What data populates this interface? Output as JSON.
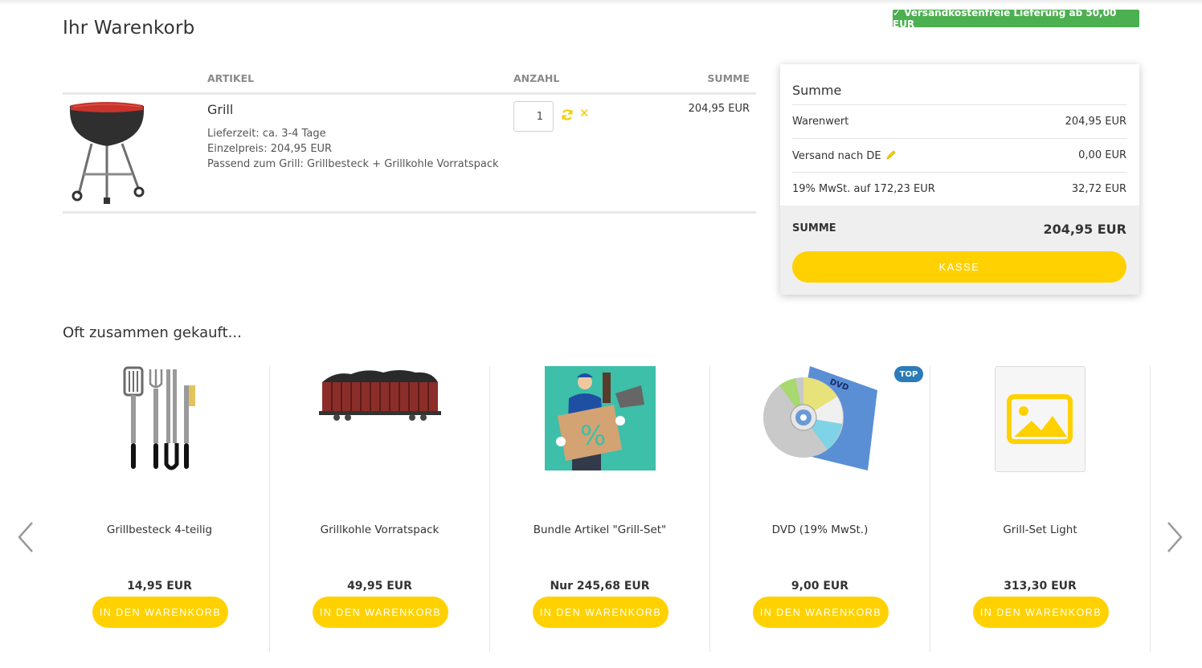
{
  "header": {
    "title": "Ihr Warenkorb",
    "free_shipping": "✓ Versandkostenfreie Lieferung ab 50,00 EUR"
  },
  "cart": {
    "columns": {
      "artikel": "ARTIKEL",
      "anzahl": "ANZAHL",
      "summe": "SUMME"
    },
    "items": [
      {
        "name": "Grill",
        "lieferzeit": "Lieferzeit: ca. 3-4 Tage",
        "einzelpreis": "Einzelpreis: 204,95 EUR",
        "passend": "Passend zum Grill: Grillbesteck + Grillkohle Vorratspack",
        "quantity": "1",
        "sum": "204,95 EUR",
        "icon": "grill-image"
      }
    ]
  },
  "summary": {
    "title": "Summe",
    "warenwert_label": "Warenwert",
    "warenwert_value": "204,95 EUR",
    "versand_label": "Versand nach DE",
    "versand_value": "0,00 EUR",
    "mwst_label": "19% MwSt. auf 172,23 EUR",
    "mwst_value": "32,72 EUR",
    "total_label": "SUMME",
    "total_value": "204,95 EUR",
    "checkout_label": "KASSE"
  },
  "recommendations": {
    "title": "Oft zusammen gekauft...",
    "button_label": "IN DEN WARENKORB",
    "products": [
      {
        "name": "Grillbesteck 4-teilig",
        "price": "14,95 EUR",
        "icon": "grill-tools-image"
      },
      {
        "name": "Grillkohle Vorratspack",
        "price": "49,95 EUR",
        "icon": "coal-wagon-image"
      },
      {
        "name": "Bundle Artikel \"Grill-Set\"",
        "price": "Nur 245,68 EUR",
        "icon": "bundle-image"
      },
      {
        "name": "DVD (19% MwSt.)",
        "price": "9,00 EUR",
        "icon": "dvd-image",
        "badge": "TOP"
      },
      {
        "name": "Grill-Set Light",
        "price": "313,30 EUR",
        "icon": "placeholder-image"
      }
    ]
  },
  "colors": {
    "accent": "#ffd100",
    "success": "#4caf50",
    "badge": "#2b7bb9"
  }
}
